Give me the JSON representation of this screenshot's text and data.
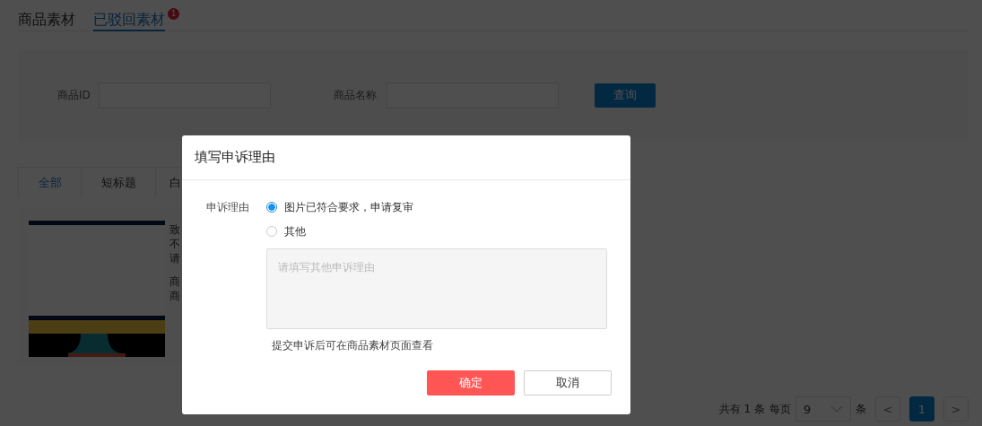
{
  "tabs": [
    {
      "label": "商品素材",
      "selected": false
    },
    {
      "label": "已驳回素材",
      "selected": true,
      "badge": "1"
    }
  ],
  "search": {
    "fields": [
      {
        "label": "商品ID"
      },
      {
        "label": "商品名称"
      }
    ],
    "button": "查询"
  },
  "filter_tabs": [
    {
      "label": "全部",
      "selected": true
    },
    {
      "label": "短标题",
      "selected": false
    },
    {
      "label": "白",
      "selected": false
    }
  ],
  "card": {
    "lines": [
      "致",
      "不",
      "请",
      "商",
      "商"
    ]
  },
  "pagination": {
    "total": "共有 1 条",
    "per_page_label": "每页",
    "per_page": "9",
    "unit": "条",
    "prev": "<",
    "pages": [
      {
        "label": "1",
        "selected": true
      }
    ],
    "next": ">"
  },
  "dialog": {
    "title": "填写申诉理由",
    "field_label": "申诉理由",
    "options": [
      {
        "label": "图片已符合要求，申请复审",
        "selected": true
      },
      {
        "label": "其他",
        "selected": false
      }
    ],
    "textarea": {
      "placeholder": "请填写其他申诉理由"
    },
    "hint": "提交申诉后可在商品素材页面查看",
    "buttons": [
      {
        "label": "确定",
        "kind": "primary"
      },
      {
        "label": "取消",
        "kind": "default"
      }
    ]
  }
}
